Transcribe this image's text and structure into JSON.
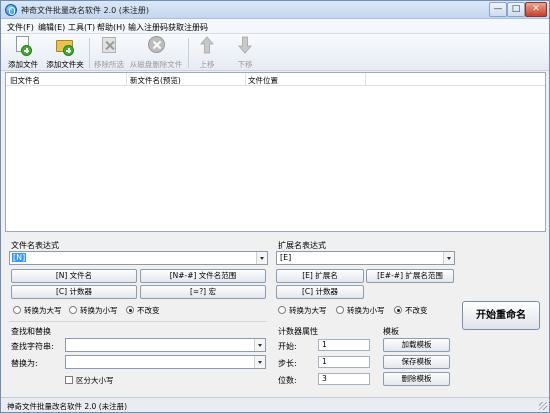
{
  "window": {
    "title": "神奇文件批量改名软件 2.0 (未注册)",
    "minimize": "—",
    "maximize": "□",
    "close": "✕"
  },
  "menu": [
    {
      "label": "文件(F)"
    },
    {
      "label": "编辑(E)"
    },
    {
      "label": "工具(T)"
    },
    {
      "label": "帮助(H)"
    },
    {
      "label": "输入注册码"
    },
    {
      "label": "获取注册码"
    }
  ],
  "toolbar": {
    "add_file": "添加文件",
    "add_folder": "添加文件夹",
    "remove_selected": "移除所选",
    "delete_from_disk": "从磁盘删除文件",
    "move_up": "上移",
    "move_down": "下移"
  },
  "list": {
    "columns": [
      "旧文件名",
      "新文件名(预览)",
      "文件位置"
    ],
    "rows": []
  },
  "filename_expr": {
    "label": "文件名表达式",
    "value": "[N]",
    "buttons": [
      "[N] 文件名",
      "[N#-#] 文件名范围",
      "[C] 计数器",
      "[=?] 宏"
    ],
    "case_options": [
      "转换为大写",
      "转换为小写",
      "不改变"
    ],
    "case_selected": "不改变"
  },
  "ext_expr": {
    "label": "扩展名表达式",
    "value": "[E]",
    "buttons": [
      "[E] 扩展名",
      "[E#-#] 扩展名范围",
      "[C] 计数器"
    ],
    "case_options": [
      "转换为大写",
      "转换为小写",
      "不改变"
    ],
    "case_selected": "不改变"
  },
  "find_replace": {
    "label": "查找和替换",
    "find_label": "查找字符串:",
    "find_value": "",
    "replace_label": "替换为:",
    "replace_value": "",
    "case_sensitive": "区分大小写",
    "case_sensitive_checked": false
  },
  "counter": {
    "label": "计数器属性",
    "start_label": "开始:",
    "start_value": "1",
    "step_label": "步长:",
    "step_value": "1",
    "digits_label": "位数:",
    "digits_value": "3"
  },
  "template": {
    "label": "模板",
    "load": "加载模板",
    "save": "保存模板",
    "delete": "删除模板"
  },
  "start_rename": "开始重命名",
  "status": "神奇文件批量改名软件 2.0 (未注册)",
  "colors": {
    "titlebar": "#c4d7ee",
    "selection": "#3399ff",
    "window_bg": "#f0f0f0"
  }
}
